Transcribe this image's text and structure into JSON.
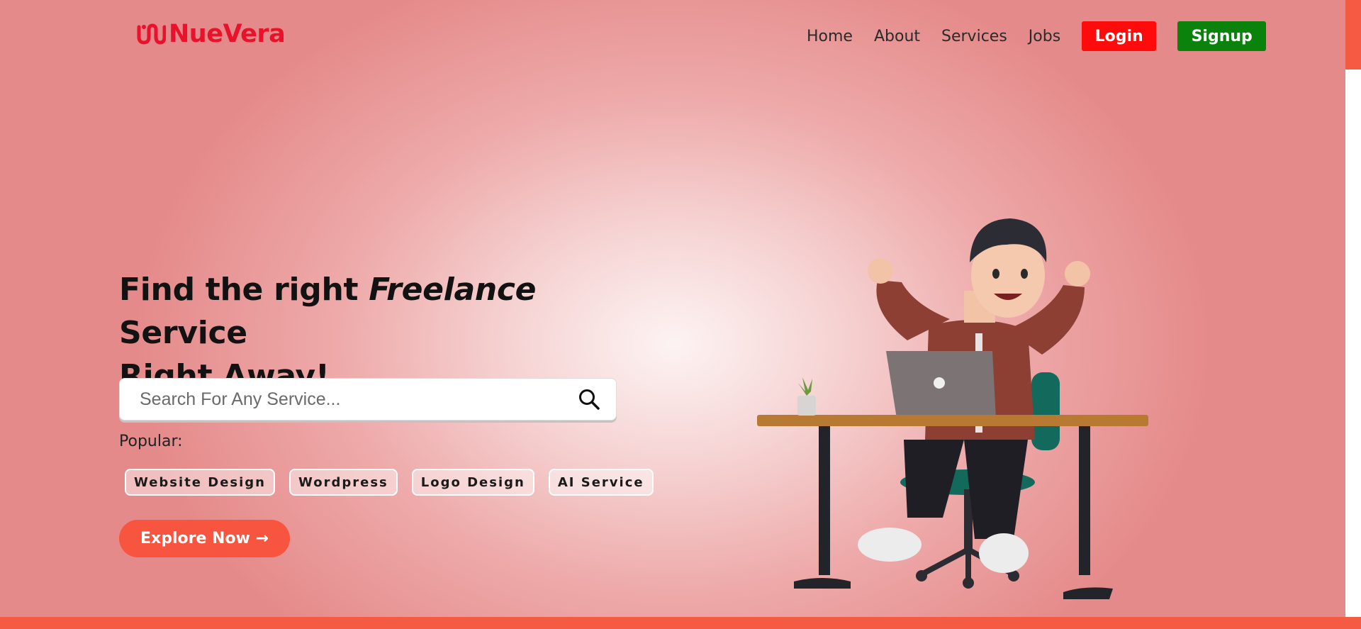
{
  "brand": {
    "name": "NueVera",
    "color": "#e8132a",
    "icon": "brand-logo-icon"
  },
  "nav": {
    "links": [
      "Home",
      "About",
      "Services",
      "Jobs"
    ],
    "login_label": "Login",
    "signup_label": "Signup"
  },
  "hero": {
    "headline_part1": "Find the right ",
    "headline_em": "Freelance",
    "headline_part2": " Service",
    "headline_line2": "Right Away!",
    "search_placeholder": "Search For Any Service...",
    "popular_label": "Popular:",
    "tags": [
      "Website Design",
      "Wordpress",
      "Logo Design",
      "AI Service"
    ],
    "cta_label": "Explore Now →"
  },
  "colors": {
    "accent": "#f55a43",
    "login": "#ff0b0b",
    "signup": "#0b820b"
  }
}
